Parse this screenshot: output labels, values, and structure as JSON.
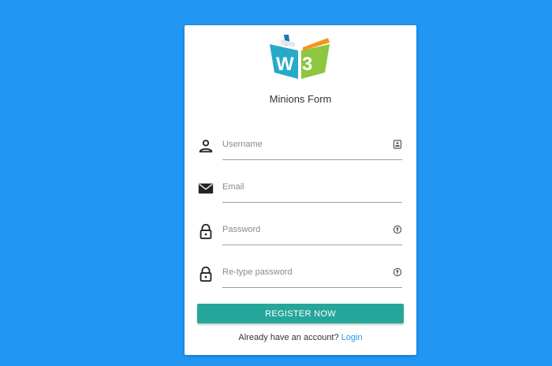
{
  "form": {
    "title": "Minions Form",
    "logo_label": "W3",
    "fields": [
      {
        "placeholder": "Username",
        "icon": "person-icon",
        "trail_icon": "contact-card-icon"
      },
      {
        "placeholder": "Email",
        "icon": "mail-icon"
      },
      {
        "placeholder": "Password",
        "icon": "lock-icon",
        "trail_icon": "key-icon"
      },
      {
        "placeholder": "Re-type password",
        "icon": "lock-icon",
        "trail_icon": "key-icon"
      }
    ],
    "register_label": "REGISTER NOW",
    "footer_text": "Already have an account?",
    "login_link": "Login"
  },
  "colors": {
    "background": "#2196f3",
    "button": "#26a69a",
    "link": "#2196f3"
  }
}
